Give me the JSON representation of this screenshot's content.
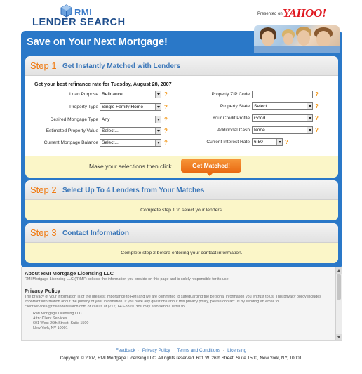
{
  "header": {
    "logo_small": "RMI",
    "logo_name": "LENDER SEARCH",
    "presented_by": "Presented on",
    "partner": "YAHOO!"
  },
  "hero": {
    "title": "Save on Your Next Mortgage!"
  },
  "step1": {
    "num": "Step 1",
    "title": "Get Instantly Matched with Lenders",
    "subhead": "Get your best refinance rate for Tuesday, August 28, 2007",
    "left_fields": [
      {
        "label": "Loan Purpose",
        "value": "Refinance"
      },
      {
        "label": "Property Type",
        "value": "Single Family Home"
      },
      {
        "label": "Desired Mortgage Type",
        "value": "Any"
      },
      {
        "label": "Estimated Property Value",
        "value": "Select..."
      },
      {
        "label": "Current Mortgage Balance",
        "value": "Select..."
      }
    ],
    "right_fields": [
      {
        "label": "Property ZIP Code",
        "value": ""
      },
      {
        "label": "Property State",
        "value": "Select..."
      },
      {
        "label": "Your Credit Profile",
        "value": "Good"
      },
      {
        "label": "Additional Cash",
        "value": "None"
      },
      {
        "label": "Current Interest Rate",
        "value": "6.50"
      }
    ],
    "help": "?",
    "cta_text": "Make your selections then click",
    "cta_button": "Get Matched!"
  },
  "step2": {
    "num": "Step 2",
    "title": "Select Up To 4 Lenders from Your Matches",
    "note": "Complete step 1 to select your lenders."
  },
  "step3": {
    "num": "Step 3",
    "title": "Contact Information",
    "note": "Complete step 2 before entering your contact information."
  },
  "legal": {
    "about_title": "About RMI Mortgage Licensing LLC",
    "about_text": "RMI Mortgage Licensing LLC (\"RMI\") collects the information you provide on this page and is solely responsible for its use.",
    "privacy_title": "Privacy Policy",
    "privacy_text": "The privacy of your information is of the greatest importance to RMI and we are committed to safeguarding the personal information you entrust to us. This privacy policy includes important information about the privacy of your information. If you have any questions about this privacy policy, please contact us by sending an email to clientservices@rmilendersearch.com or call us at (212) 643-8320. You may also send a letter to:",
    "address": [
      "RMI Mortgage Licensing LLC",
      "Attn: Client Services",
      "601 West 26th Street, Suite 1500",
      "New York, NY 10001"
    ]
  },
  "footer": {
    "links": [
      "Feedback",
      "Privacy Policy",
      "Terms and Conditions",
      "Licensing"
    ],
    "copyright": "Copyright © 2007, RMI Mortgage Licensing LLC. All rights reserved. 601 W. 26th Street, Suite 1500, New York, NY, 10001"
  },
  "colors": {
    "brand_blue": "#2a78c8",
    "step_orange": "#f07a10",
    "cta_orange": "#e96a12",
    "note_yellow": "#fbf6c8"
  }
}
